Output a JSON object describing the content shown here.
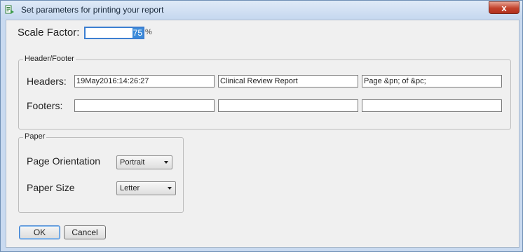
{
  "window": {
    "title": "Set parameters for printing your report",
    "icon": "report-settings-icon",
    "close_label": "x"
  },
  "scale": {
    "label": "Scale Factor:",
    "value": "75",
    "unit": "%"
  },
  "header_footer": {
    "legend": "Header/Footer",
    "headers_label": "Headers:",
    "footers_label": "Footers:",
    "headers": [
      "19May2016:14:26:27",
      "Clinical Review Report",
      "Page &pn; of &pc;"
    ],
    "footers": [
      "",
      "",
      ""
    ]
  },
  "paper": {
    "legend": "Paper",
    "orientation_label": "Page Orientation",
    "orientation_value": "Portrait",
    "size_label": "Paper Size",
    "size_value": "Letter"
  },
  "buttons": {
    "ok": "OK",
    "cancel": "Cancel"
  },
  "colors": {
    "title_bar": "#c6d8ef",
    "client_bg": "#f0f0f0",
    "focus_accent": "#3c7fd1",
    "close_button": "#c2412b"
  }
}
